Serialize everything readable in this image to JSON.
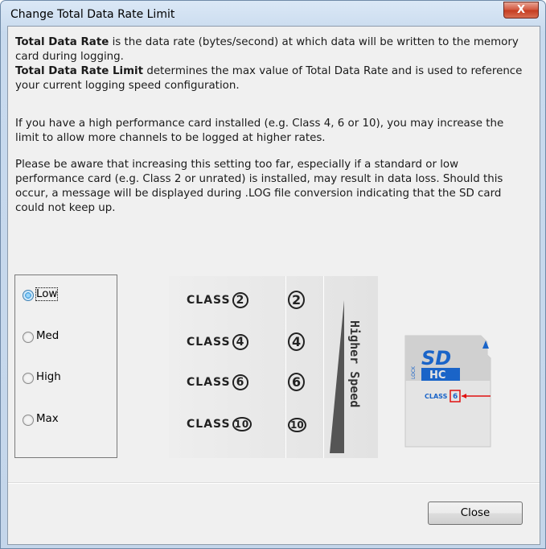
{
  "window": {
    "title": "Change Total Data Rate Limit",
    "close_glyph": "X"
  },
  "intro": {
    "p1_bold": "Total Data Rate",
    "p1_rest": " is the data rate (bytes/second) at which data will be written to the memory card during logging.",
    "p2_bold": "Total Data Rate Limit",
    "p2_rest": " determines the max value of Total Data Rate and is used to reference your current logging speed configuration.",
    "p3": "If you have a high performance card installed (e.g. Class 4, 6 or 10), you may increase the limit to allow more channels to be logged at higher rates.",
    "p4": "Please be aware that increasing this setting too far, especially if a standard or low performance card (e.g. Class 2 or unrated) is installed, may result in data loss.  Should this occur, a message will be displayed during .LOG file conversion indicating that the SD card could not keep up."
  },
  "options": {
    "selected": "Low",
    "items": [
      "Low",
      "Med",
      "High",
      "Max"
    ]
  },
  "classes": {
    "word": "CLASS",
    "numbers": [
      "2",
      "4",
      "6",
      "10"
    ],
    "speed_label": "Higher Speed"
  },
  "sdcard": {
    "brand": "SD",
    "type": "HC",
    "side_text": "LOCK",
    "class_word": "CLASS",
    "class_number": "6"
  },
  "footer": {
    "close_label": "Close"
  },
  "colors": {
    "window_frame": "#c4d6ea",
    "close_red": "#c43b1f",
    "highlight": "#e01010",
    "sd_blue": "#1a64c8"
  }
}
